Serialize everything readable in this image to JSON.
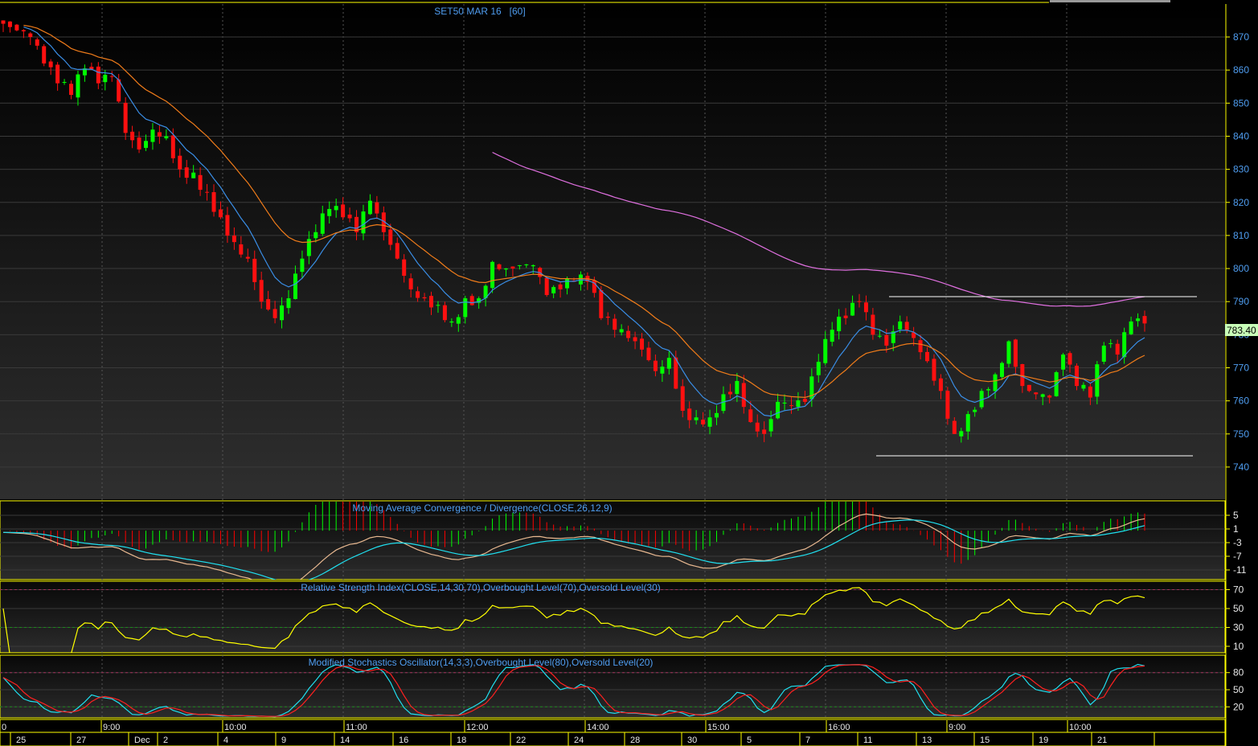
{
  "chart_data": {
    "type": "candlestick",
    "title": "SET50 MAR 16   [60]",
    "last_price": "783.40",
    "price_axis": {
      "ticks": [
        870,
        860,
        850,
        840,
        830,
        820,
        810,
        800,
        790,
        780,
        770,
        760,
        750,
        740
      ],
      "ylim": [
        735,
        878
      ]
    },
    "closes": [
      874,
      872,
      870,
      862,
      856,
      852.5,
      860.5,
      856,
      858,
      841,
      836,
      842,
      840,
      830,
      829,
      823,
      815.5,
      808,
      803,
      790,
      785,
      791,
      803,
      811,
      818,
      815.5,
      811,
      820.5,
      811,
      803,
      793.7,
      791,
      789,
      784,
      791,
      791,
      802,
      800,
      801,
      801,
      792,
      793.7,
      796,
      796,
      785,
      781.5,
      779,
      775.5,
      769,
      773,
      757,
      755,
      755,
      762,
      766,
      753.6,
      750,
      759.7,
      758.5,
      759.7,
      771.8,
      781.5,
      785,
      790,
      780,
      776.7,
      784,
      779,
      772,
      763,
      750,
      756,
      763,
      768,
      778,
      764.5,
      762,
      761,
      774,
      764.5,
      761,
      776.7,
      774,
      784,
      783.4
    ],
    "moving_averages": [
      {
        "name": "fast MA",
        "color": "#3a8ee6",
        "period": 8
      },
      {
        "name": "slow MA",
        "color": "#f07c1a",
        "period": 20
      },
      {
        "name": "long MA",
        "color": "#e070e0",
        "period": 60
      }
    ],
    "horizontal_lines": [
      {
        "name": "resistance",
        "price": 791.5,
        "color": "#ffffff"
      },
      {
        "name": "support",
        "price": 743.4,
        "color": "#ffffff"
      }
    ],
    "indicators": {
      "macd": {
        "title": "Moving Average Convergence / Divergence(CLOSE,26,12,9)",
        "ticks": [
          5,
          1,
          -3,
          -7,
          -11
        ],
        "ylim": [
          -13.5,
          7.5
        ],
        "macd_color": "#e8b890",
        "signal_color": "#20e0f0",
        "up_color": "#00ff00",
        "down_color": "#ff0000"
      },
      "rsi": {
        "title": "Relative Strength Index(CLOSE,14,30,70),Overbought Level(70),Oversold Level(30)",
        "ticks": [
          70,
          50,
          30,
          10
        ],
        "ylim": [
          -2,
          78
        ],
        "overbought": 70,
        "oversold": 30,
        "color": "#ffff00"
      },
      "stochastic": {
        "title": "Modified Stochastics Oscillator(14,3,3),Overbought Level(80),Oversold Level(20)",
        "ticks": [
          80,
          50,
          20
        ],
        "ylim": [
          -4,
          104
        ],
        "overbought": 80,
        "oversold": 20,
        "k_color": "#20e0f0",
        "d_color": "#ff2020"
      }
    },
    "time_axis": {
      "hours": [
        "0",
        "9:00",
        "10:00",
        "11:00",
        "12:00",
        "14:00",
        "15:00",
        "16:00",
        "9:00",
        "10:00"
      ],
      "dates": [
        "25",
        "27",
        "Dec",
        "2",
        "4",
        "9",
        "14",
        "16",
        "18",
        "22",
        "24",
        "28",
        "30",
        "5",
        "7",
        "11",
        "13",
        "15",
        "19",
        "21"
      ]
    },
    "colors": {
      "up": "#00ff00",
      "down": "#ff1010",
      "axis": "#ffff00",
      "label": "#4f9df0"
    }
  }
}
